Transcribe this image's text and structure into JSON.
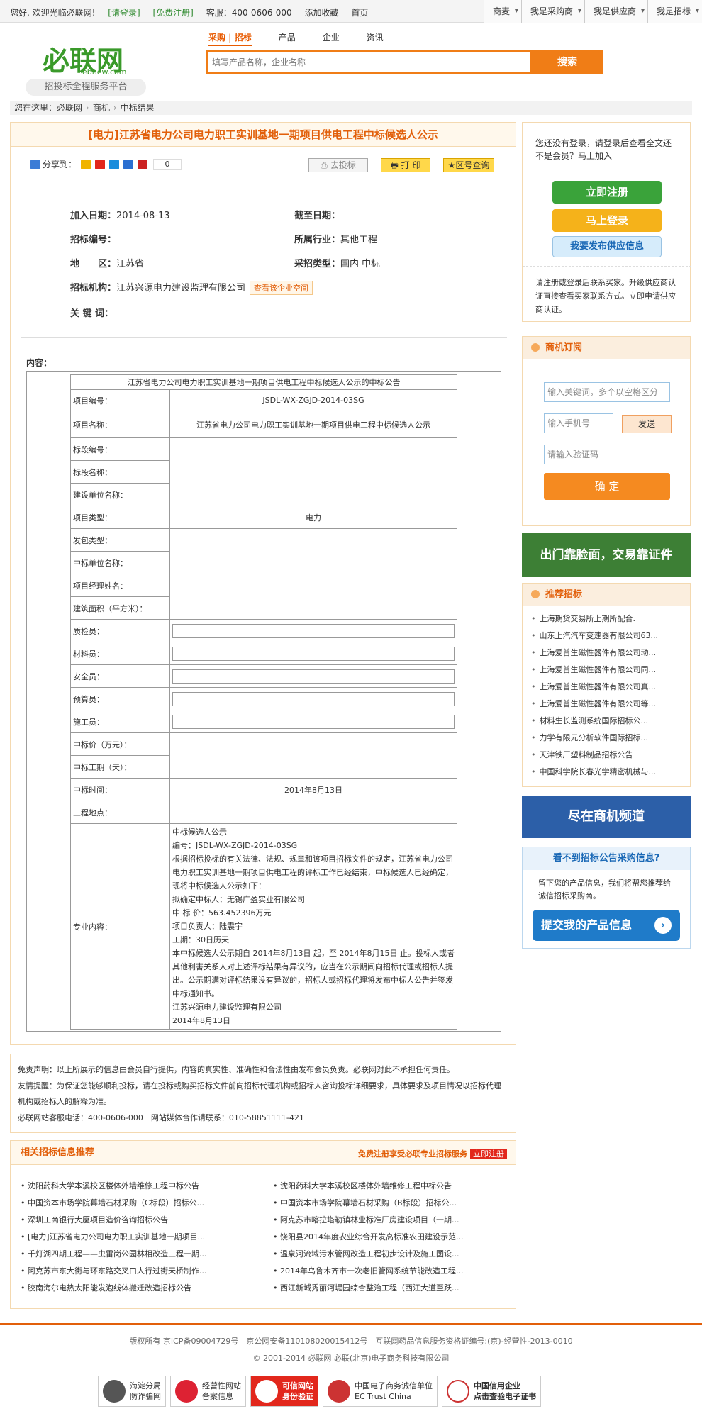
{
  "topbar": {
    "welcome": "您好, 欢迎光临必联网!",
    "login": "[请登录]",
    "register": "[免费注册]",
    "hotline": "客服：400-0606-000",
    "favorite": "添加收藏",
    "home": "首页",
    "right_tabs": [
      "商麦",
      "我是采购商",
      "我是供应商",
      "我是招标"
    ]
  },
  "logo": {
    "text": "必联网",
    "domain": "ebnew.com",
    "slogan": "招投标全程服务平台"
  },
  "search": {
    "tabs": [
      "采购 | 招标",
      "产品",
      "企业",
      "资讯"
    ],
    "placeholder": "填写产品名称，企业名称",
    "button": "搜索"
  },
  "breadcrumb": {
    "label": "您在这里：",
    "items": [
      "必联网",
      "商机",
      "中标结果"
    ]
  },
  "article": {
    "title": "[电力]江苏省电力公司电力职工实训基地一期项目供电工程中标候选人公示",
    "share_label": "分享到：",
    "share_count": "0",
    "btn_bid": "去投标",
    "btn_print": "打 印",
    "btn_region": "区号查询",
    "meta": {
      "join_date_label": "加入日期：",
      "join_date": "2014-08-13",
      "deadline_label": "截至日期：",
      "deadline": "",
      "bid_no_label": "招标编号：",
      "bid_no": "",
      "industry_label": "所属行业：",
      "industry": "其他工程",
      "region_label": "地　　区：",
      "region": "江苏省",
      "purchase_type_label": "采招类型：",
      "purchase_type": "国内 中标",
      "agency_label": "招标机构：",
      "agency": "江苏兴源电力建设监理有限公司",
      "view_space": "查看该企业空间",
      "keywords_label": "关 键 词：",
      "keywords": ""
    },
    "content_label": "内容："
  },
  "notice_table": {
    "caption": "江苏省电力公司电力职工实训基地一期项目供电工程中标候选人公示的中标公告",
    "rows": [
      {
        "label": "项目编号：",
        "value": "JSDL-WX-ZGJD-2014-03SG"
      },
      {
        "label": "项目名称：",
        "value": "江苏省电力公司电力职工实训基地一期项目供电工程中标候选人公示"
      },
      {
        "label": "标段编号：",
        "value": ""
      },
      {
        "label": "标段名称：",
        "value": ""
      },
      {
        "label": "建设单位名称：",
        "value": ""
      },
      {
        "label": "项目类型：",
        "value": "电力"
      },
      {
        "label": "发包类型：",
        "value": ""
      },
      {
        "label": "中标单位名称：",
        "value": ""
      },
      {
        "label": "项目经理姓名：",
        "value": ""
      },
      {
        "label": "建筑面积（平方米）：",
        "value": ""
      },
      {
        "label": "质检员：",
        "value": ""
      },
      {
        "label": "材料员：",
        "value": ""
      },
      {
        "label": "安全员：",
        "value": ""
      },
      {
        "label": "预算员：",
        "value": ""
      },
      {
        "label": "施工员：",
        "value": ""
      },
      {
        "label": "中标价（万元）：",
        "value": ""
      },
      {
        "label": "中标工期（天）：",
        "value": ""
      },
      {
        "label": "中标时间：",
        "value": "2014年8月13日"
      },
      {
        "label": "工程地点：",
        "value": ""
      }
    ],
    "prose_label": "专业内容：",
    "prose": [
      "中标候选人公示",
      "编号：JSDL-WX-ZGJD-2014-03SG",
      "根据招标投标的有关法律、法规、规章和该项目招标文件的规定，江苏省电力公司电力职工实训基地一期项目供电工程的评标工作已经结束，中标候选人已经确定，现将中标候选人公示如下：",
      "拟确定中标人：无锡广盈实业有限公司",
      "中 标 价：563.452396万元",
      "项目负责人：陆震宇",
      "工期：30日历天",
      "本中标候选人公示期自 2014年8月13日 起，至 2014年8月15日 止。投标人或者其他利害关系人对上述评标结果有异议的，应当在公示期间向招标代理或招标人提出。公示期满对评标结果没有异议的，招标人或招标代理将发布中标人公告并签发中标通知书。",
      "江苏兴源电力建设监理有限公司",
      "2014年8月13日"
    ]
  },
  "sidebar": {
    "login_tip": "您还没有登录，请登录后查看全文还不是会员？马上加入",
    "btn_register": "立即注册",
    "btn_login": "马上登录",
    "btn_publish": "我要发布供应信息",
    "supplier_tip": "请注册或登录后联系买家。升级供应商认证直接查看买家联系方式。立即申请供应商认证。",
    "subscribe_title": "商机订阅",
    "kw_placeholder": "输入关键词，多个以空格区分",
    "phone_placeholder": "输入手机号",
    "send": "发送",
    "code_placeholder": "请输入验证码",
    "confirm": "确 定",
    "banner1": "出门靠脸面，交易靠证件",
    "recommend_title": "推荐招标",
    "recommend": [
      "上海期货交易所上期所配合.",
      "山东上汽汽车变速器有限公司63...",
      "上海爱普生磁性器件有限公司动...",
      "上海爱普生磁性器件有限公司同...",
      "上海爱普生磁性器件有限公司真...",
      "上海爱普生磁性器件有限公司等...",
      "材料生长监测系统国际招标公...",
      "力学有限元分析软件国际招标...",
      "天津铁厂塑料制品招标公告",
      "中国科学院长春光学精密机械与..."
    ],
    "banner2": "尽在商机频道",
    "cant_find": "看不到招标公告采购信息?",
    "cant_find_tip": "留下您的产品信息，我们将帮您推荐给诚信招标采购商。",
    "submit": "提交我的产品信息"
  },
  "disclaimer": {
    "line1": "免责声明：以上所展示的信息由会员自行提供，内容的真实性、准确性和合法性由发布会员负责。必联网对此不承担任何责任。",
    "line2": "友情提醒：为保证您能够顺利投标，请在投标或购买招标文件前向招标代理机构或招标人咨询投标详细要求，具体要求及项目情况以招标代理机构或招标人的解释为准。",
    "line3": "必联网站客服电话：400-0606-000　网站媒体合作请联系：010-58851111-421"
  },
  "related": {
    "title": "相关招标信息推荐",
    "promo": "免费注册享受必联专业招标服务",
    "promo_btn": "立即注册",
    "left": [
      "沈阳药科大学本溪校区楼体外墙维修工程中标公告",
      "中国资本市场学院幕墙石材采购（C标段）招标公...",
      "深圳工商银行大厦项目造价咨询招标公告",
      "[电力]江苏省电力公司电力职工实训基地一期项目...",
      "千灯湖四期工程——虫雷岗公园林相改造工程一期...",
      "阿克苏市东大街与环东路交叉口人行过街天桥制作...",
      "胶南海尔电热太阳能发泡线体搬迁改造招标公告"
    ],
    "right": [
      "沈阳药科大学本溪校区楼体外墙维修工程中标公告",
      "中国资本市场学院幕墙石材采购（B标段）招标公...",
      "阿克苏市喀拉塔勒镇林业标准厂房建设项目（一期...",
      "饶阳县2014年度农业综合开发高标准农田建设示范...",
      "温泉河流域污水管网改造工程初步设计及施工图设...",
      "2014年乌鲁木齐市一次老旧管网系统节能改造工程...",
      "西江新城秀丽河堤园综合整治工程（西江大道至跃..."
    ]
  },
  "footer": {
    "line1": "版权所有 京ICP备09004729号　京公网安备110108020015412号　互联网药品信息服务资格证编号:(京)-经营性-2013-0010",
    "line2": "© 2001-2014 必联网 必联(北京)电子商务科技有限公司",
    "badges": [
      {
        "t1": "海淀分局",
        "t2": "防诈骗网"
      },
      {
        "t1": "经营性网站",
        "t2": "备案信息"
      },
      {
        "t1": "可信网站",
        "t2": "身份验证"
      },
      {
        "t1": "中国电子商务诚信单位",
        "t2": "EC Trust China"
      },
      {
        "t1": "中国信用企业",
        "t2": "点击查验电子证书"
      }
    ]
  },
  "colors": {
    "brand_orange": "#f07d16",
    "title_orange": "#e25f0a",
    "brand_green": "#3a9a2a"
  }
}
